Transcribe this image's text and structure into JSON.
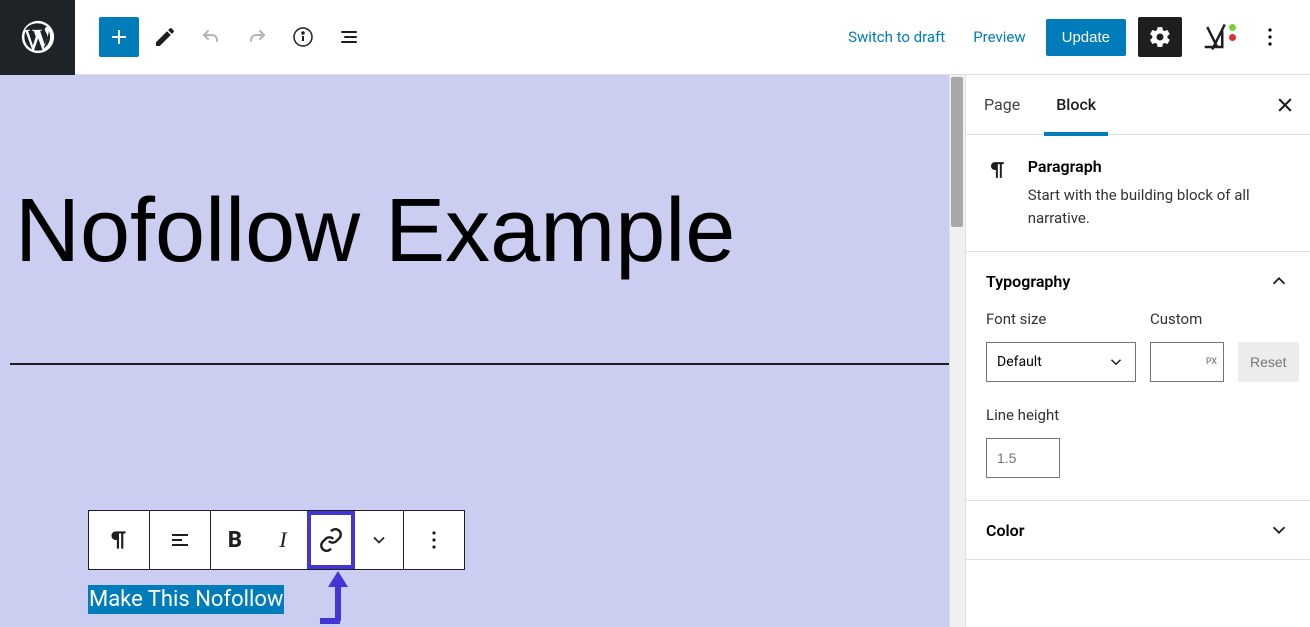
{
  "toolbar": {
    "switch_to_draft": "Switch to draft",
    "preview": "Preview",
    "update": "Update"
  },
  "editor": {
    "title": "Nofollow Example",
    "selected_text": "Make This Nofollow"
  },
  "sidebar": {
    "tab_page": "Page",
    "tab_block": "Block",
    "block": {
      "name": "Paragraph",
      "description": "Start with the building block of all narrative."
    },
    "typography": {
      "label": "Typography",
      "font_size_label": "Font size",
      "font_size_value": "Default",
      "custom_label": "Custom",
      "px_unit": "PX",
      "reset": "Reset",
      "line_height_label": "Line height",
      "line_height_placeholder": "1.5"
    },
    "color": {
      "label": "Color"
    }
  }
}
